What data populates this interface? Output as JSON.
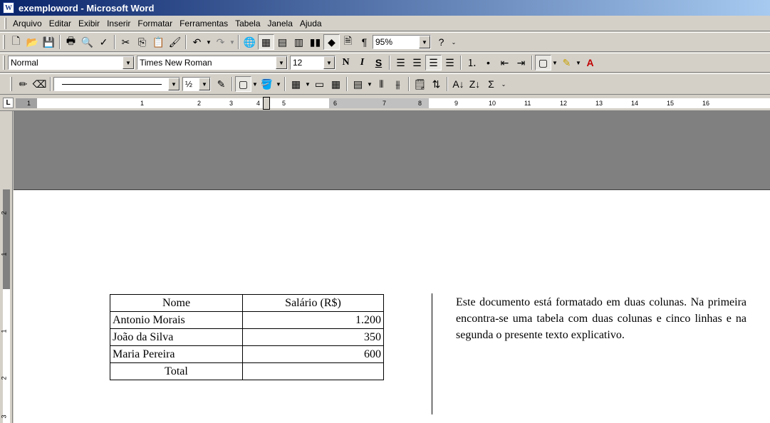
{
  "window": {
    "title": "exemploword - Microsoft Word",
    "app_icon": "word-icon"
  },
  "menu": [
    "Arquivo",
    "Editar",
    "Exibir",
    "Inserir",
    "Formatar",
    "Ferramentas",
    "Tabela",
    "Janela",
    "Ajuda"
  ],
  "toolbar_standard": {
    "zoom": "95%"
  },
  "toolbar_format": {
    "style": "Normal",
    "font": "Times New Roman",
    "size": "12"
  },
  "toolbar_tables": {
    "line_weight": "½"
  },
  "ruler": {
    "numbers": [
      "1",
      "1",
      "2",
      "3",
      "4",
      "5",
      "6",
      "7",
      "8",
      "9",
      "10",
      "11",
      "12",
      "13",
      "14",
      "15",
      "16"
    ]
  },
  "vruler": {
    "numbers": [
      "2",
      "1",
      "1",
      "2",
      "3"
    ]
  },
  "document": {
    "table": {
      "headers": [
        "Nome",
        "Salário (R$)"
      ],
      "rows": [
        [
          "Antonio Morais",
          "1.200"
        ],
        [
          "João da Silva",
          "350"
        ],
        [
          "Maria Pereira",
          "600"
        ]
      ],
      "total_label": "Total",
      "total_value": ""
    },
    "paragraph": "Este documento está formatado em duas colunas. Na primeira encontra-se uma tabela com duas colunas e cinco linhas e na segunda o presente texto explicativo."
  }
}
